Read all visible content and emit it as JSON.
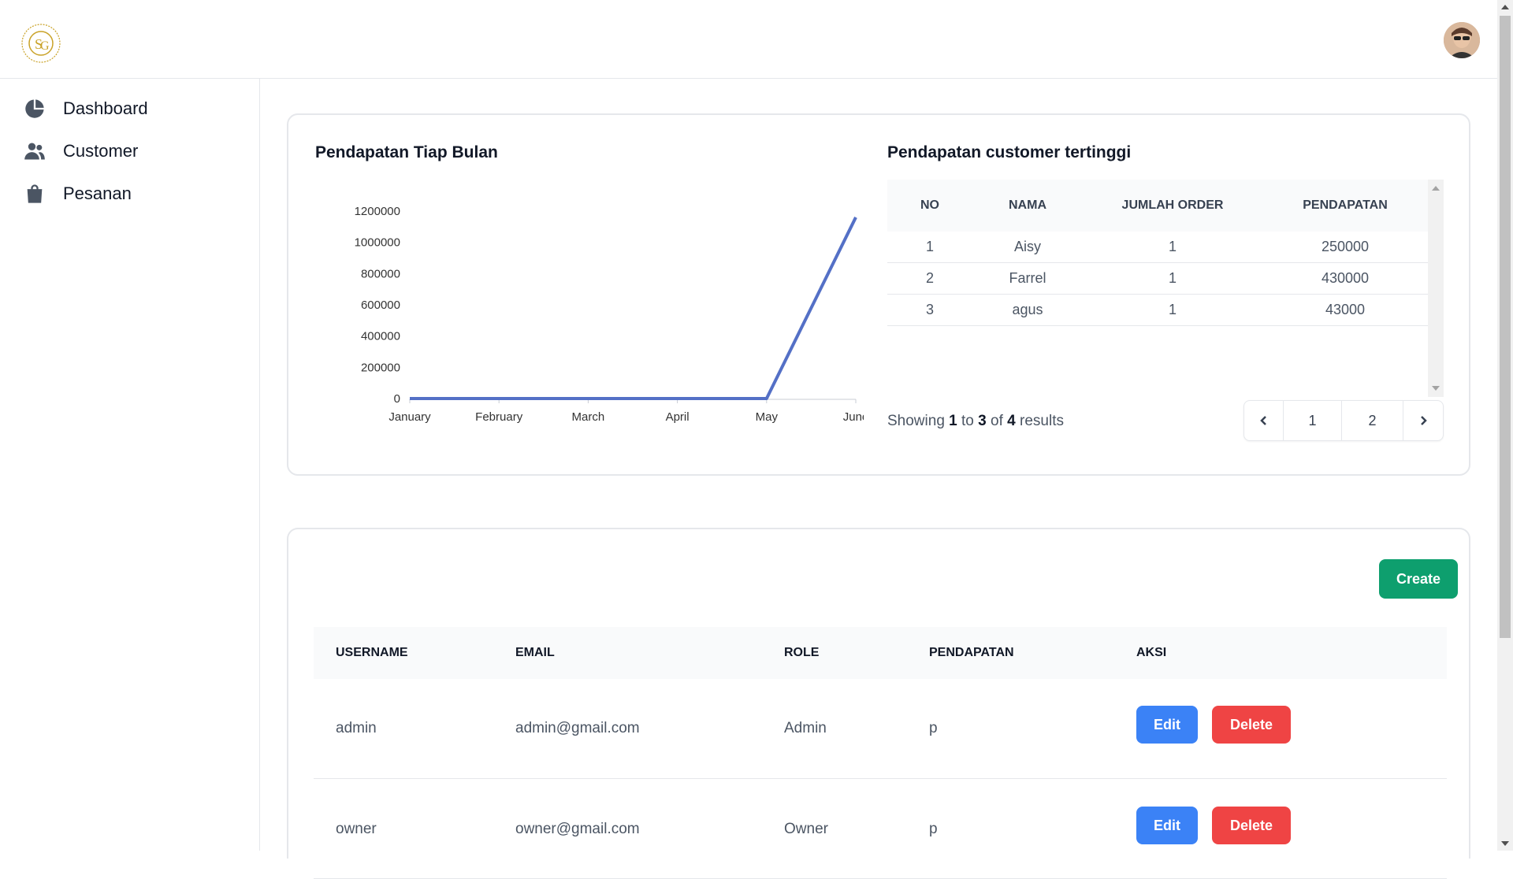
{
  "sidebar": {
    "items": [
      {
        "label": "Dashboard",
        "icon": "pie-chart-icon"
      },
      {
        "label": "Customer",
        "icon": "users-icon"
      },
      {
        "label": "Pesanan",
        "icon": "shopping-bag-icon"
      }
    ]
  },
  "dashboard": {
    "chart_title": "Pendapatan Tiap Bulan",
    "table_title": "Pendapatan customer tertinggi",
    "top_table": {
      "headers": [
        "NO",
        "NAMA",
        "JUMLAH ORDER",
        "PENDAPATAN"
      ],
      "rows": [
        [
          "1",
          "Aisy",
          "1",
          "250000"
        ],
        [
          "2",
          "Farrel",
          "1",
          "430000"
        ],
        [
          "3",
          "agus",
          "1",
          "43000"
        ]
      ]
    },
    "showing": {
      "prefix": "Showing",
      "from": "1",
      "to_word": "to",
      "to": "3",
      "of_word": "of",
      "total": "4",
      "suffix": "results"
    },
    "pager": {
      "page1": "1",
      "page2": "2"
    }
  },
  "chart_data": {
    "type": "line",
    "categories": [
      "January",
      "February",
      "March",
      "April",
      "May",
      "June"
    ],
    "series": [
      {
        "values": [
          0,
          0,
          0,
          0,
          0,
          1160000
        ],
        "color": "#5470c6"
      }
    ],
    "yticks": [
      "0",
      "200000",
      "400000",
      "600000",
      "800000",
      "1000000",
      "1200000"
    ],
    "ylim": [
      0,
      1200000
    ],
    "title": "Pendapatan Tiap Bulan",
    "xlabel": "",
    "ylabel": ""
  },
  "users": {
    "create_label": "Create",
    "headers": {
      "username": "USERNAME",
      "email": "EMAIL",
      "role": "ROLE",
      "pendapatan": "PENDAPATAN",
      "aksi": "AKSI"
    },
    "rows": [
      {
        "username": "admin",
        "email": "admin@gmail.com",
        "role": "Admin",
        "pendapatan": "p",
        "edit": "Edit",
        "delete": "Delete"
      },
      {
        "username": "owner",
        "email": "owner@gmail.com",
        "role": "Owner",
        "pendapatan": "p",
        "edit": "Edit",
        "delete": "Delete"
      }
    ]
  },
  "colors": {
    "accent_green": "#0e9f6e",
    "edit_blue": "#3b82f6",
    "delete_red": "#ef4444",
    "line_blue": "#5470c6"
  }
}
